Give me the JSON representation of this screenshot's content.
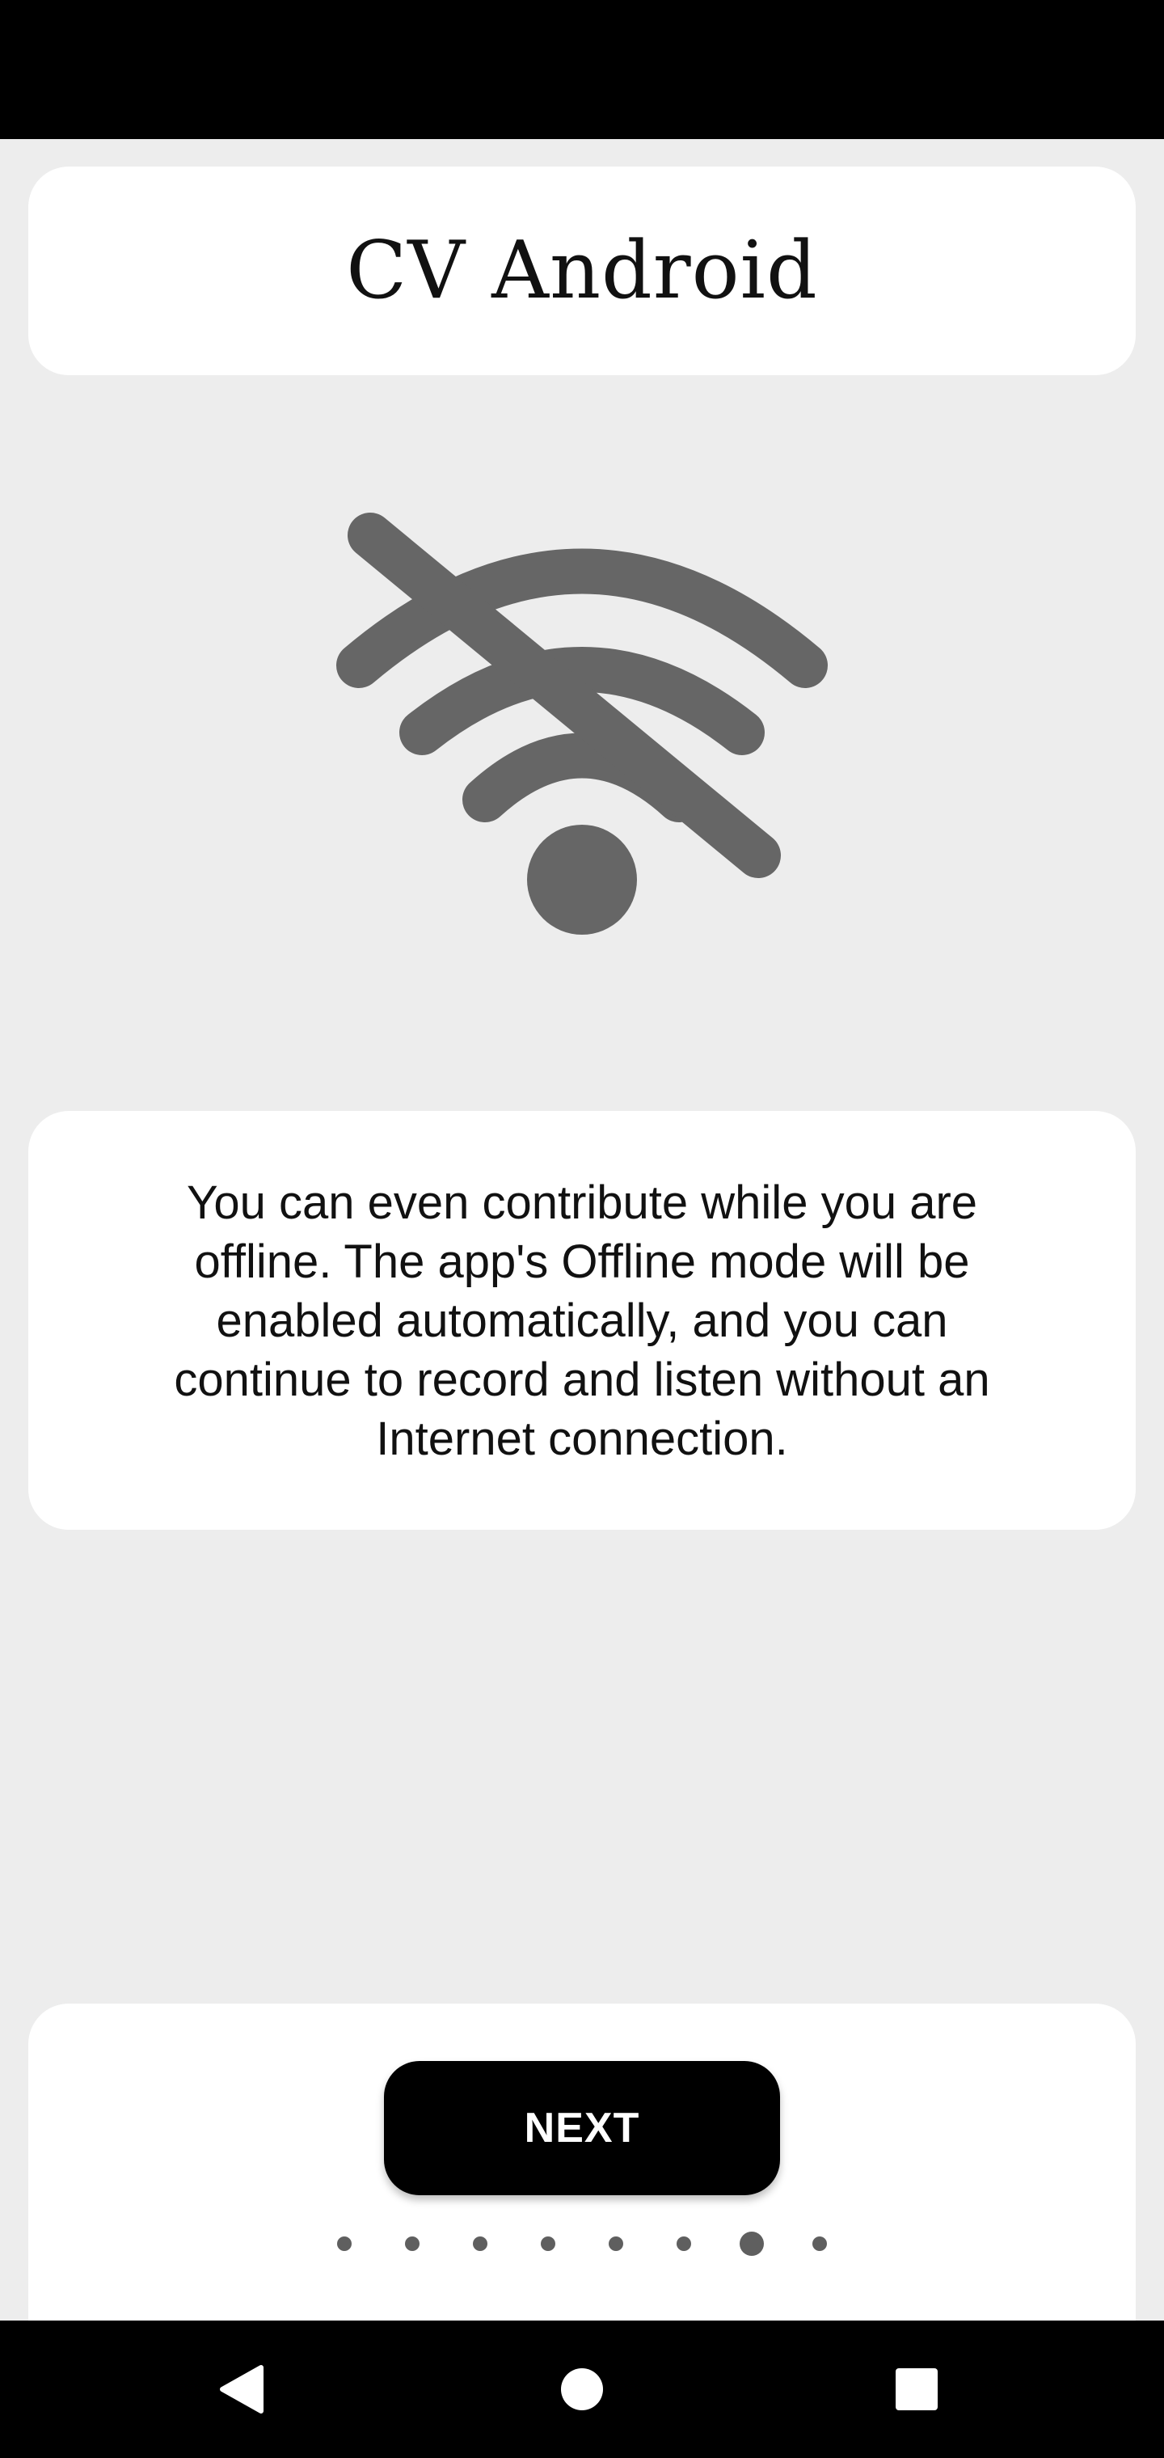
{
  "header": {
    "title": "CV Android"
  },
  "illustration": {
    "icon": "wifi-off-icon",
    "color": "#666666"
  },
  "message": {
    "text": "You can even contribute while you are offline. The app's Offline mode will be enabled automatically, and you can continue to record and listen without an Internet connection."
  },
  "footer": {
    "next_label": "NEXT",
    "page_indicator": {
      "total": 8,
      "current": 7
    }
  },
  "navigation": {
    "back_icon": "back-triangle-icon",
    "home_icon": "home-circle-icon",
    "recents_icon": "recents-square-icon"
  },
  "colors": {
    "background": "#ededed",
    "card": "#ffffff",
    "button": "#000000",
    "icon": "#666666"
  }
}
